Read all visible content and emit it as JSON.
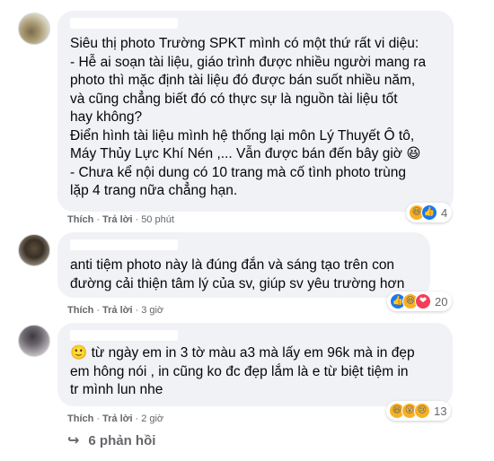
{
  "comments": [
    {
      "text": "Siêu thị photo Trường SPKT mình có một thứ rất vi diệu:\n- Hễ ai soạn tài liệu, giáo trình được nhiều người mang ra\nphoto thì mặc định tài liệu đó được bán suốt nhiều năm,\nvà cũng chẳng biết đó có thực sự là nguồn tài liệu tốt\nhay không?\nĐiển hình tài liệu mình hệ thống lại môn Lý Thuyết Ô tô,\nMáy Thủy Lực Khí Nén ,... Vẫn được bán đến bây giờ 😆\n- Chưa kể nội dung có 10 trang mà cố tình photo trùng\nlặp 4 trang nữa chẳng hạn.",
      "like": "Thích",
      "reply": "Trả lời",
      "time": "50 phút",
      "reaction_count": "4",
      "reaction_icons": [
        "haha",
        "like"
      ]
    },
    {
      "text": "anti tiệm photo này là đúng đắn và sáng tạo trên con\nđường cải thiện tâm lý của sv, giúp sv yêu trường hơn",
      "like": "Thích",
      "reply": "Trả lời",
      "time": "3 giờ",
      "reaction_count": "20",
      "reaction_icons": [
        "like",
        "haha",
        "love"
      ]
    },
    {
      "text": "🙂 từ ngày em in 3 tờ màu a3 mà lấy em 96k mà in đẹp\nem hông nói , in cũng ko đc đẹp lắm là e từ biệt tiệm in\ntr mình lun nhe",
      "like": "Thích",
      "reply": "Trả lời",
      "time": "2 giờ",
      "reaction_count": "13",
      "reaction_icons": [
        "haha",
        "wow",
        "sad"
      ]
    }
  ],
  "replies_link": "6 phản hồi",
  "colors": {
    "bubble": "#f0f2f5",
    "secondary_text": "#65676b",
    "like_blue": "#1877f2",
    "love_red": "#f33e58",
    "emoji_yellow": "#f7b125"
  }
}
